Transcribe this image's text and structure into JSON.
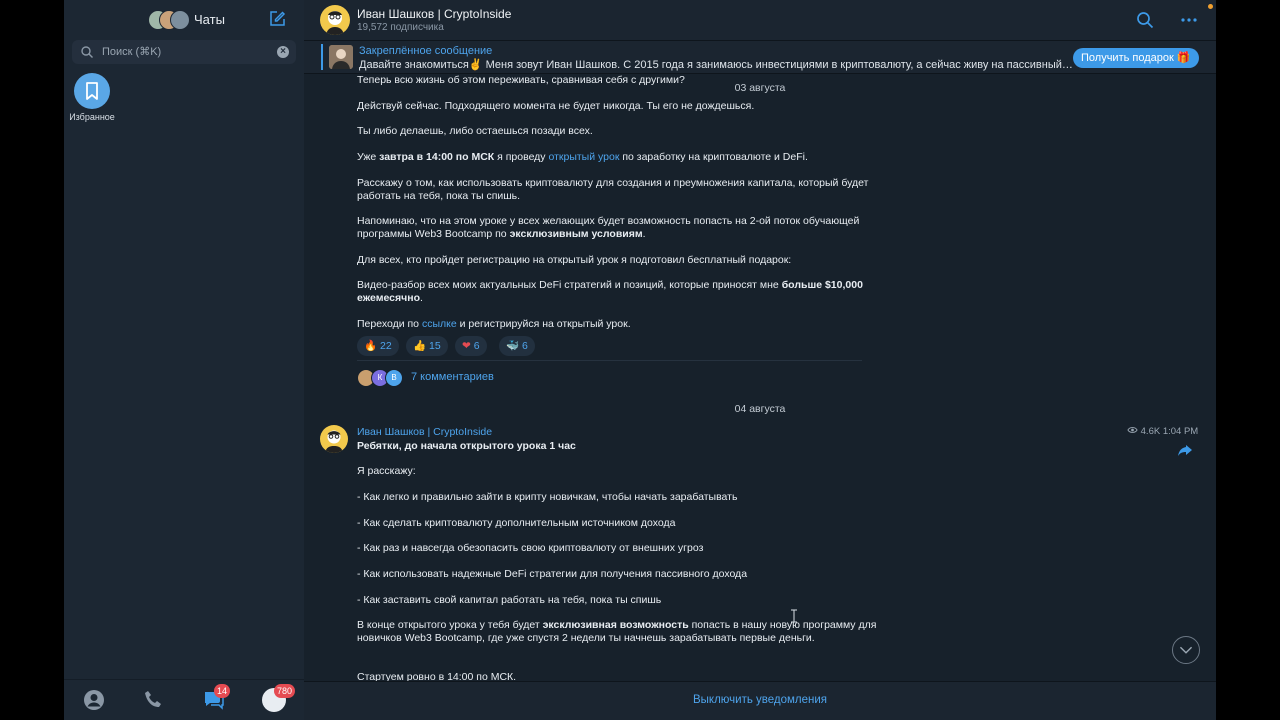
{
  "sidebar": {
    "title": "Чаты",
    "search_placeholder": "Поиск (⌘K)",
    "favorites_label": "Избранное",
    "tabs": {
      "chats_badge": "14",
      "profile_badge": "780"
    }
  },
  "header": {
    "title": "Иван Шашков | CryptoInside",
    "subtitle": "19,572 подписчика"
  },
  "pinned": {
    "title": "Закреплённое сообщение",
    "text": "Давайте знакомиться✌️ Меня зовут Иван Шашков. С 2015 года я занимаюсь инвестициями в криптовалюту, а сейчас живу на пассивный…",
    "button": "Получить подарок 🎁"
  },
  "post1": {
    "line0": "Теперь всю жизнь об этом переживать, сравнивая себя с другими?",
    "date": "03 августа",
    "p1": "Действуй сейчас. Подходящего момента не будет никогда. Ты его не дождешься.",
    "p2": "Ты либо делаешь, либо остаешься позади всех.",
    "p3a": "Уже ",
    "p3b": "завтра в 14:00 по МСК",
    "p3c": " я проведу ",
    "p3d": "открытый урок",
    "p3e": " по заработку на криптовалюте и DeFi.",
    "p4": "Расскажу о том, как использовать криптовалюту для создания и преумножения капитала, который будет работать на тебя, пока ты спишь.",
    "p5a": "Напоминаю, что на этом уроке у всех желающих будет возможность попасть на 2-ой поток обучающей программы Web3 Bootcamp по ",
    "p5b": "эксклюзивным условиям",
    "p5c": ".",
    "p6": "Для всех, кто пройдет регистрацию на открытый урок я подготовил бесплатный подарок:",
    "p7a": "Видео-разбор всех моих актуальных DeFi стратегий и позиций, которые приносят мне ",
    "p7b": "больше $10,000 ежемесячно",
    "p7c": ".",
    "p8a": "Переходи по ",
    "p8b": "ссылке",
    "p8c": " и регистрируйся на открытый урок.",
    "reactions": [
      {
        "emoji": "🔥",
        "count": "22"
      },
      {
        "emoji": "👍",
        "count": "15"
      },
      {
        "emoji": "❤",
        "count": "6"
      },
      {
        "emoji": "🐳",
        "count": "6"
      }
    ],
    "comment_avatars": [
      "К",
      "В"
    ],
    "comments": "7 комментариев"
  },
  "date2": "04 августа",
  "post2": {
    "author": "Иван Шашков | CryptoInside",
    "views": "4.6K",
    "time": "1:04 PM",
    "headline": "Ребятки, до начала открытого урока 1 час",
    "intro": "Я расскажу:",
    "items": [
      "- Как легко и правильно зайти в крипту новичкам, чтобы начать зарабатывать",
      "- Как сделать криптовалюту дополнительным источником дохода",
      "- Как раз и навсегда обезопасить свою криптовалюту от внешних угроз",
      "- Как использовать надежные DeFi стратегии для получения пассивного дохода",
      "- Как заставить свой капитал работать на тебя, пока ты спишь"
    ],
    "outro_a": "В конце открытого урока у тебя будет ",
    "outro_b": "эксклюзивная возможность",
    "outro_c": " попасть в нашу новую программу для новичков Web3 Bootcamp, где уже спустя 2 недели ты начнешь зарабатывать первые деньги.",
    "start": "Стартуем ровно в 14:00 по МСК."
  },
  "footer": {
    "mute": "Выключить уведомления"
  },
  "colors": {
    "accent": "#3d9ae8",
    "background": "#17212b",
    "sidebar": "#1c2733",
    "badge": "#e54b52"
  }
}
